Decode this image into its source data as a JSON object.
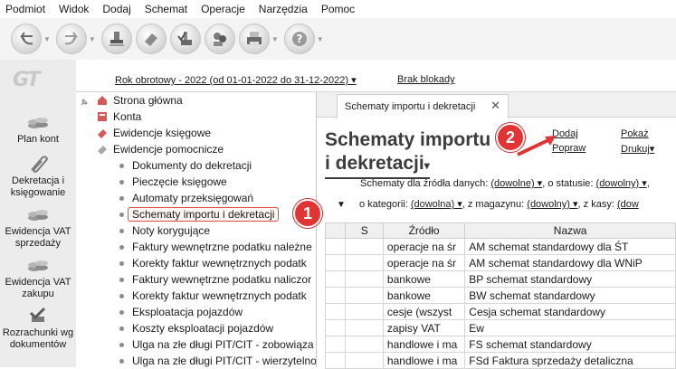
{
  "menu": [
    "Podmiot",
    "Widok",
    "Dodaj",
    "Schemat",
    "Operacje",
    "Narzędzia",
    "Pomoc"
  ],
  "toolbar_icons": [
    "back-arrow-icon",
    "forward-arrow-icon",
    "stamp-icon",
    "eraser-icon",
    "approve-stamp-icon",
    "people-icon",
    "printer-icon",
    "help-icon"
  ],
  "logo": "GT",
  "left_nav": [
    {
      "label": "Plan kont",
      "icon": "coins-stack-icon"
    },
    {
      "label": "Dekretacja i księgowanie",
      "icon": "paperclip-icon"
    },
    {
      "label": "Ewidencja VAT sprzedaży",
      "icon": "coins-stack-icon"
    },
    {
      "label": "Ewidencja VAT zakupu",
      "icon": "coins-stack-icon"
    },
    {
      "label": "Rozrachunki wg dokumentów",
      "icon": "check-stamp-icon"
    }
  ],
  "header": {
    "year": "Rok obrotowy - 2022  (od 01-01-2022 do 31-12-2022)",
    "lock": "Brak blokady"
  },
  "tree": {
    "top_items": [
      "Strona główna",
      "Konta",
      "Ewidencje księgowe",
      "Ewidencje pomocnicze"
    ],
    "sub_items": [
      "Dokumenty do dekretacji",
      "Pieczęcie księgowe",
      "Automaty przeksięgowań",
      "Schematy importu i dekretacji",
      "Noty korygujące",
      "Faktury wewnętrzne podatku należne",
      "Korekty faktur wewnętrznych podatk",
      "Faktury wewnętrzne podatku naliczor",
      "Korekty faktur wewnętrznych podatk",
      "Eksploatacja pojazdów",
      "Koszty eksploatacji pojazdów",
      "Ulga na złe długi PIT/CIT - zobowiąza",
      "Ulga na złe długi PIT/CIT - wierzytelno"
    ]
  },
  "doc": {
    "tab_label": "Schematy importu i dekretacji",
    "title_line1": "Schematy importu",
    "title_line2": "i dekretacji",
    "links": {
      "add": "Dodaj",
      "fix": "Popraw",
      "show": "Pokaż",
      "print": "Drukuj"
    },
    "filter1": {
      "prefix": "Schematy dla źródła danych:",
      "v1": "(dowolne)",
      "mid1": ", o statusie:",
      "v2": "(dowolny)",
      "tail": ","
    },
    "filter2": {
      "prefix": "o kategorii:",
      "v1": "(dowolna)",
      "mid1": ", z magazynu:",
      "v2": "(dowolny)",
      "mid2": ", z kasy:",
      "v3": "(dow"
    },
    "columns": [
      "",
      "S",
      "Źródło",
      "Nazwa"
    ],
    "rows": [
      {
        "source": "operacje na śr",
        "name": "AM schemat standardowy dla ŚT"
      },
      {
        "source": "operacje na śr",
        "name": "AM schemat standardowy dla WNiP"
      },
      {
        "source": "bankowe",
        "name": "BP schemat standardowy"
      },
      {
        "source": "bankowe",
        "name": "BW schemat standardowy"
      },
      {
        "source": "cesje (wszyst",
        "name": "Cesja schemat standardowy"
      },
      {
        "source": "zapisy VAT",
        "name": "Ew"
      },
      {
        "source": "handlowe i ma",
        "name": "FS schemat standardowy"
      },
      {
        "source": "handlowe i ma",
        "name": "FSd Faktura sprzedaży detaliczna"
      }
    ]
  },
  "callouts": [
    "1",
    "2"
  ],
  "colors": {
    "callout": "#e13535",
    "selection_border": "#e14b4b"
  }
}
